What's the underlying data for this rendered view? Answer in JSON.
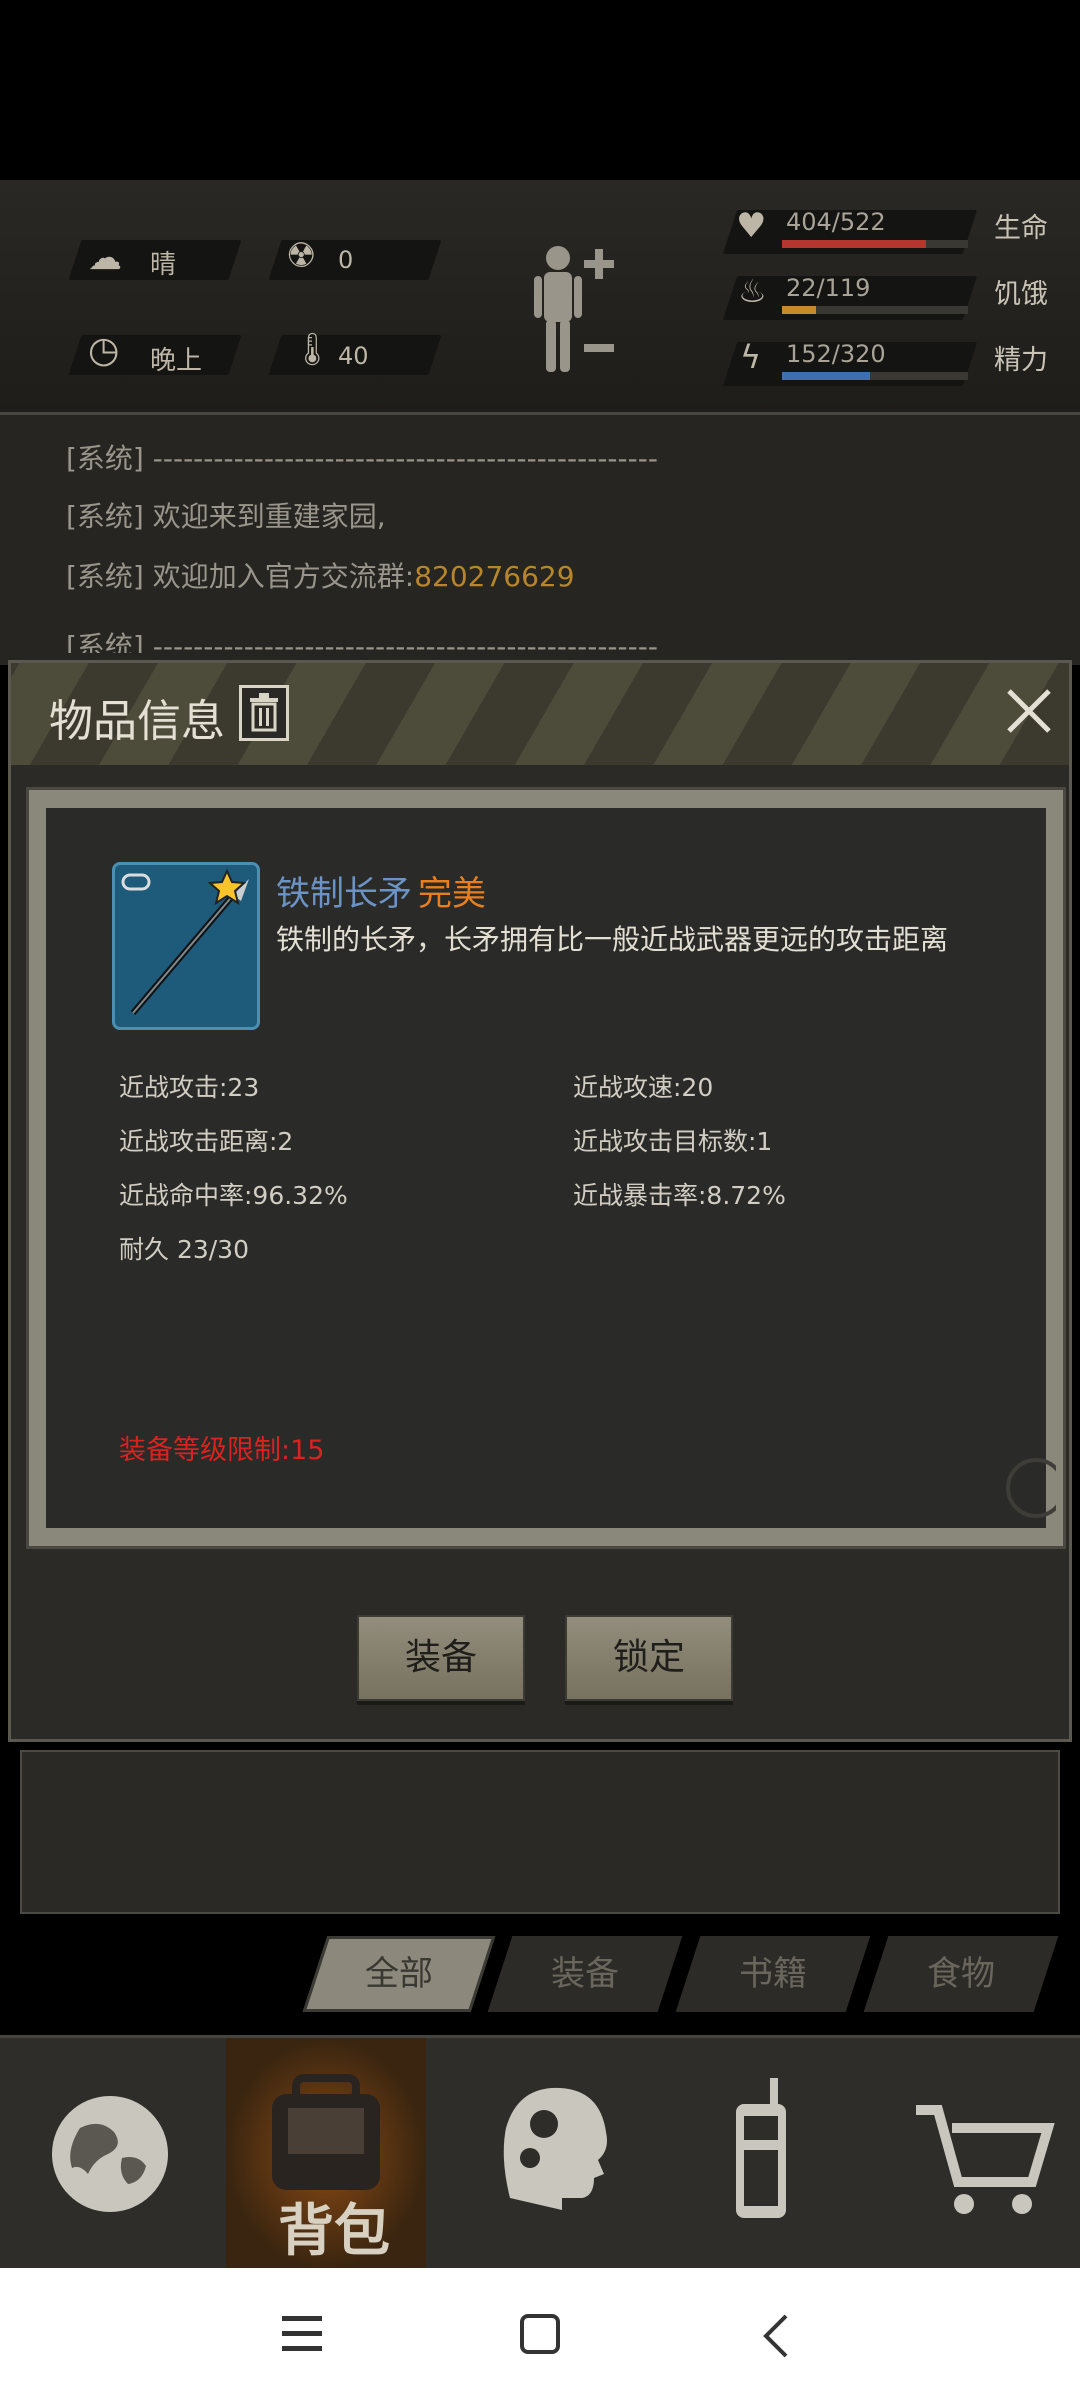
{
  "status": {
    "weather": "晴",
    "radiation": "0",
    "time_of_day": "晚上",
    "temperature": "40",
    "vitals": [
      {
        "label": "生命",
        "value": "404/522",
        "fill": 0.774,
        "color": "#b5362e"
      },
      {
        "label": "饥饿",
        "value": "22/119",
        "fill": 0.185,
        "color": "#c58a2a"
      },
      {
        "label": "精力",
        "value": "152/320",
        "fill": 0.475,
        "color": "#3e6fb0"
      }
    ]
  },
  "log": {
    "line1_prefix": "[系统]",
    "line1_text": "--------------------------------------------------",
    "line2_prefix": "[系统]",
    "line2_text": "欢迎来到重建家园,",
    "line3_prefix": "[系统]",
    "line3_text": "欢迎加入官方交流群:",
    "line3_group": "820276629",
    "line4_prefix": "[系统]",
    "line4_text": "--------------------------------------------------"
  },
  "dialog": {
    "title": "物品信息",
    "item_name": "铁制长矛",
    "item_quality": "完美",
    "item_desc": "铁制的长矛，长矛拥有比一般近战武器更远的攻击距离",
    "stats_left": [
      "近战攻击:23",
      "近战攻击距离:2",
      "近战命中率:96.32%",
      "耐久 23/30"
    ],
    "stats_right": [
      "近战攻速:20",
      "近战攻击目标数:1",
      "近战暴击率:8.72%"
    ],
    "requirement": "装备等级限制:15",
    "equip_label": "装备",
    "lock_label": "锁定"
  },
  "tabs": [
    "全部",
    "装备",
    "书籍",
    "食物"
  ],
  "bottom_nav": {
    "backpack_label": "背包"
  },
  "colors": {
    "quality": "#e87f1e",
    "item_name": "#6b93c6",
    "requirement": "#d8231f",
    "group_number": "#b8862a"
  }
}
